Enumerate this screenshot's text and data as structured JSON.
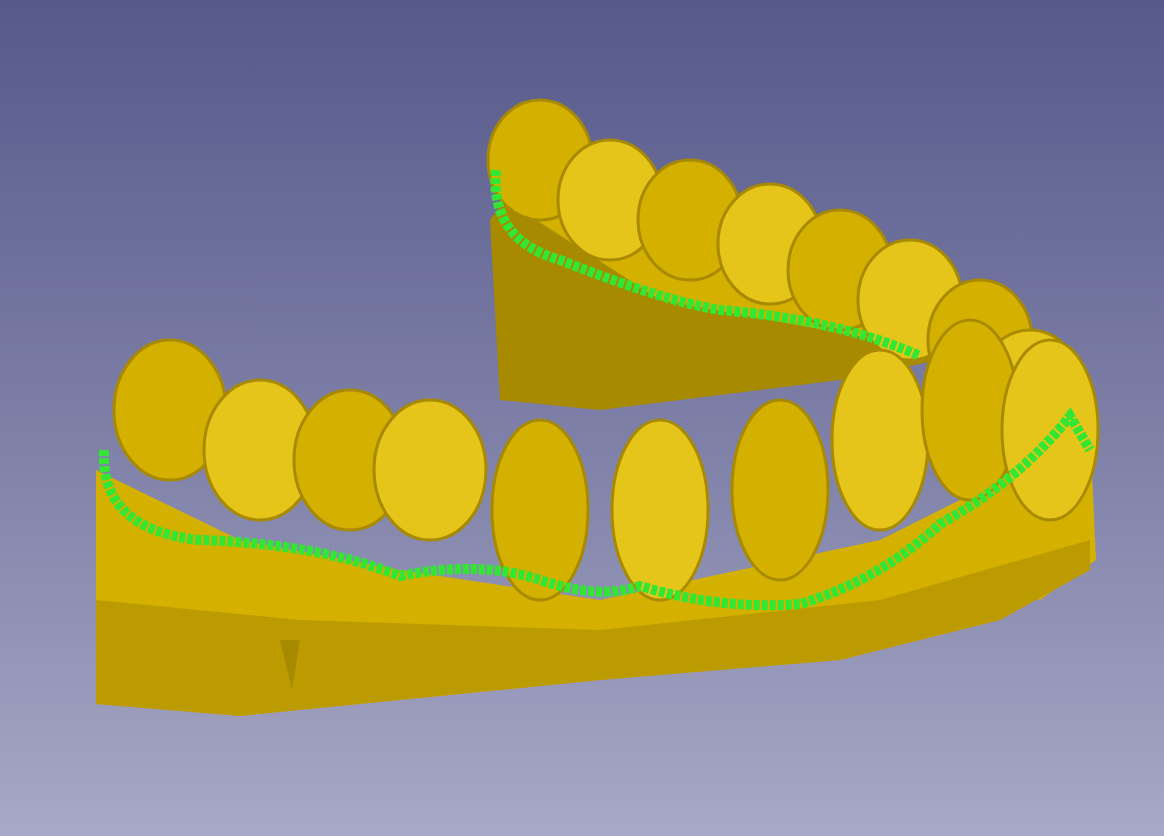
{
  "viewport": {
    "model_visible": true
  }
}
